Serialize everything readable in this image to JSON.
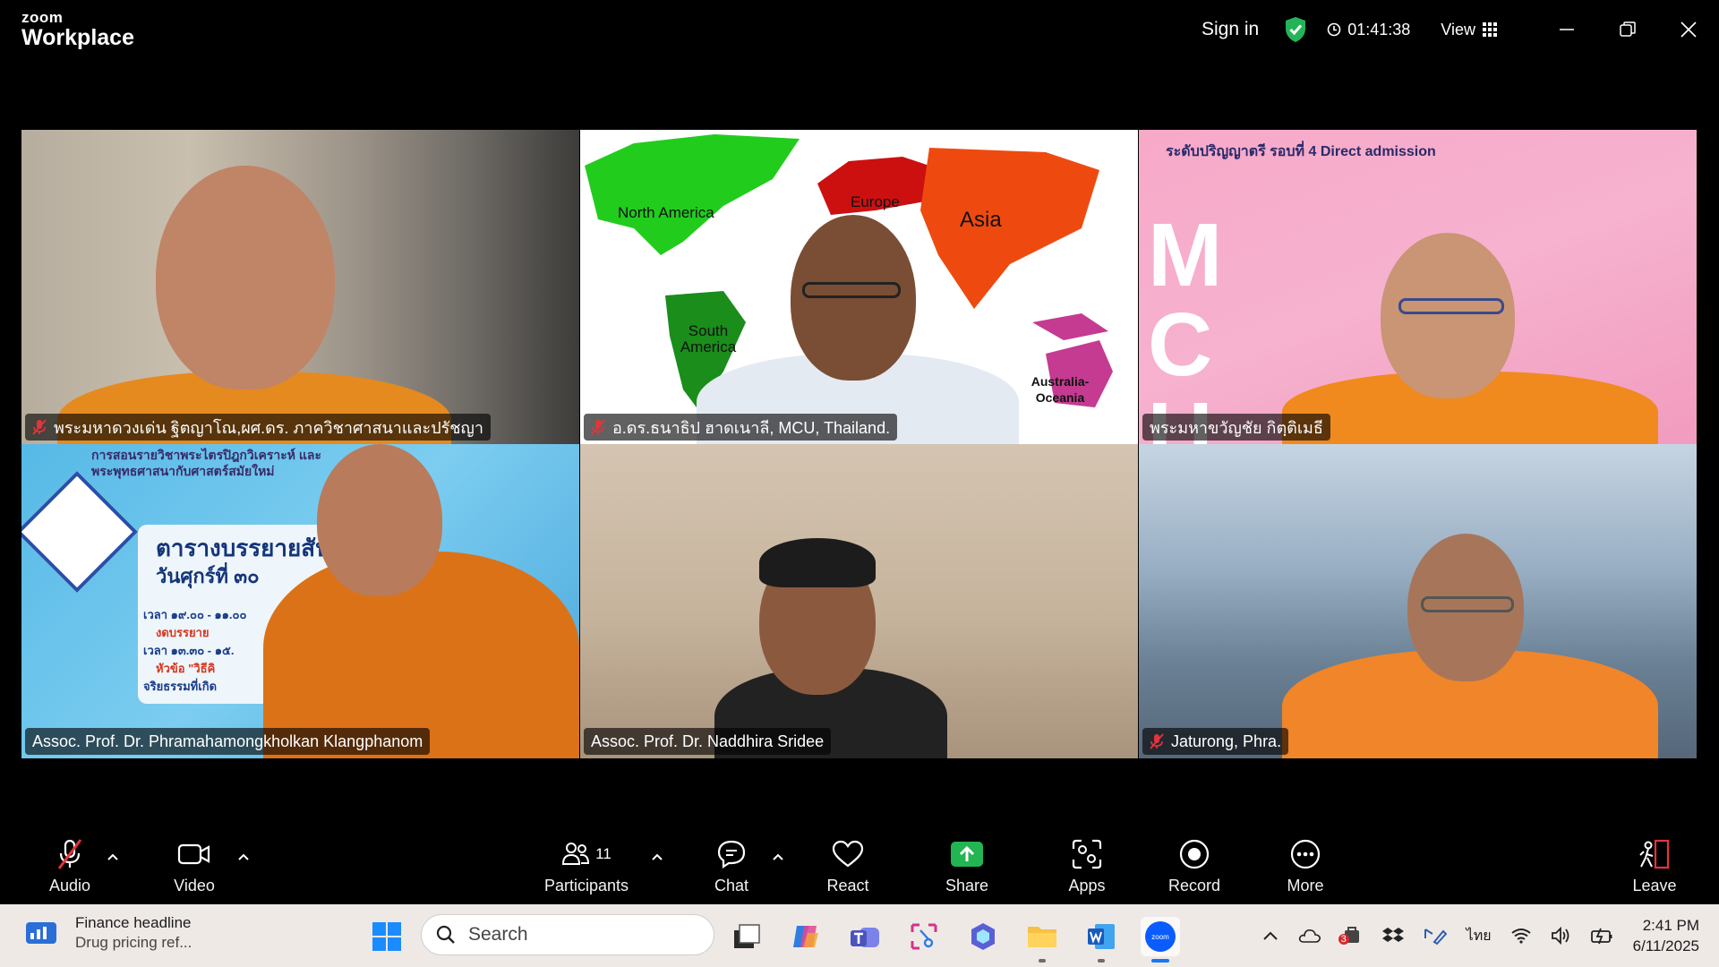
{
  "app": {
    "logo_small": "zoom",
    "logo_big": "Workplace"
  },
  "titlebar": {
    "signin": "Sign in",
    "timer": "01:41:38",
    "view_label": "View"
  },
  "tiles": [
    {
      "name": "พระมหาดวงเด่น ฐิตญาโณ,ผศ.ดร. ภาควิชาศาสนาและปรัชญา",
      "muted": true
    },
    {
      "name": "อ.ดร.ธนาธิป ฮาดเนาลี, MCU, Thailand.",
      "muted": true,
      "map_labels": [
        "North America",
        "Europe",
        "Asia",
        "South America",
        "Australia-Oceania"
      ]
    },
    {
      "name": "พระมหาขวัญชัย กิตฺติเมธี",
      "muted": false,
      "speaking": true,
      "banner_line1": "ระดับปริญญาตรี รอบที่ 4 Direct admission",
      "banner_big": "MCU"
    },
    {
      "name": "Assoc. Prof. Dr. Phramahamongkholkan Klangphanom",
      "muted": false,
      "slide_line1": "การสอนรายวิชาพระไตรปิฎกวิเคราะห์ และ",
      "slide_line2": "พระพุทธศาสนากับศาสตร์สมัยใหม่",
      "slide_title": "ตารางบรรยายสัปดา",
      "slide_day": "วันศุกร์ที่ ๓๐",
      "slide_t1": "เวลา ๑๙.๐๐ - ๑๑.๐๐",
      "slide_t2": "งดบรรยาย",
      "slide_t3": "เวลา ๑๓.๓๐ - ๑๕.",
      "slide_t4": "หัวข้อ \"วิธีคิ",
      "slide_t5": "จริยธรรมที่เกิด"
    },
    {
      "name": "Assoc. Prof. Dr. Naddhira Sridee",
      "muted": false
    },
    {
      "name": "Jaturong, Phra.",
      "muted": true
    }
  ],
  "toolbar": {
    "audio": "Audio",
    "video": "Video",
    "participants": "Participants",
    "participants_count": "11",
    "chat": "Chat",
    "react": "React",
    "share": "Share",
    "apps": "Apps",
    "record": "Record",
    "more": "More",
    "leave": "Leave"
  },
  "taskbar": {
    "widget_title": "Finance headline",
    "widget_sub": "Drug pricing ref...",
    "search_placeholder": "Search",
    "language": "ไทย",
    "time": "2:41 PM",
    "date": "6/11/2025",
    "badge": "3"
  },
  "colors": {
    "active_speaker": "#23d959",
    "share_green": "#22b552",
    "leave_red": "#e5333b",
    "taskbar_bg": "#efe9e6"
  }
}
